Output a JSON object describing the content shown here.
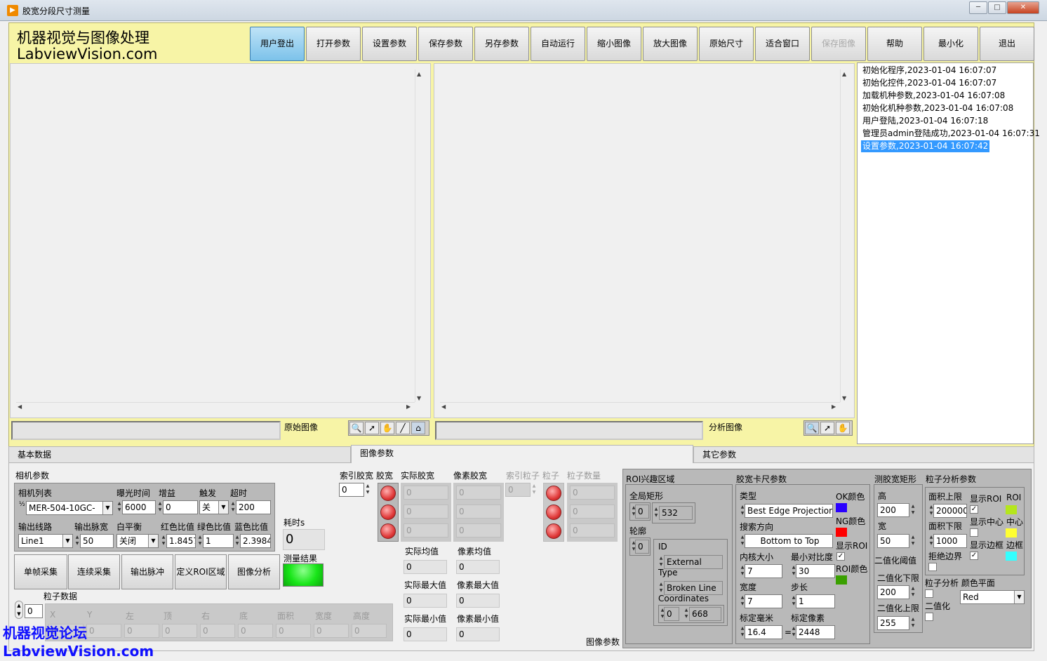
{
  "window": {
    "title": "胶宽分段尺寸测量",
    "icon": "play-icon",
    "controls": [
      "─",
      "□",
      "✕"
    ]
  },
  "brand": {
    "line1": "机器视觉与图像处理",
    "line2": "LabviewVision.com"
  },
  "toolbar": {
    "buttons": [
      "用户登出",
      "打开参数",
      "设置参数",
      "保存参数",
      "另存参数",
      "自动运行",
      "缩小图像",
      "放大图像",
      "原始尺寸",
      "适合窗口",
      "保存图像",
      "帮助",
      "最小化",
      "退出"
    ],
    "active": "用户登出",
    "disabled": "保存图像"
  },
  "panels": {
    "original_label": "原始图像",
    "analysis_label": "分析图像"
  },
  "log": {
    "items": [
      "初始化程序,2023-01-04 16:07:07",
      "初始化控件,2023-01-04 16:07:07",
      "加载机种参数,2023-01-04 16:07:08",
      "初始化机种参数,2023-01-04 16:07:08",
      "用户登陆,2023-01-04 16:07:18",
      "管理员admin登陆成功,2023-01-04 16:07:31",
      "设置参数,2023-01-04 16:07:42"
    ],
    "selected_index": 6
  },
  "tabs": {
    "items": [
      "基本数据",
      "图像参数",
      "其它参数"
    ],
    "active": "图像参数",
    "page_label": "图像参数"
  },
  "camera": {
    "title": "相机参数",
    "list_label": "相机列表",
    "list_value": "MER-504-10GC-",
    "exposure_label": "曝光时间",
    "exposure": "6000",
    "gain_label": "增益",
    "gain": "0",
    "trigger_label": "触发",
    "trigger": "关",
    "timeout_label": "超时",
    "timeout": "200",
    "line_label": "输出线路",
    "line": "Line1",
    "pulse_label": "输出脉宽",
    "pulse": "50",
    "wb_label": "白平衡",
    "wb": "关闭",
    "red_label": "红色比值",
    "red": "1.8457",
    "green_label": "绿色比值",
    "green": "1",
    "blue_label": "蓝色比值",
    "blue": "2.3984",
    "index_prefix": "½"
  },
  "elapsed": {
    "label": "耗时s",
    "value": "0"
  },
  "result": {
    "label": "测量结果",
    "color": "#19e619"
  },
  "actions": [
    "单帧采集",
    "连续采集",
    "输出脉冲",
    "定义ROI区域",
    "图像分析"
  ],
  "particles": {
    "title": "粒子数据",
    "index": "0",
    "columns": [
      "X",
      "Y",
      "左",
      "顶",
      "右",
      "底",
      "面积",
      "宽度",
      "高度"
    ],
    "row": [
      "0",
      "0",
      "0",
      "0",
      "0",
      "0",
      "0",
      "0",
      "0"
    ]
  },
  "glue": {
    "index_label": "索引胶宽",
    "index": "0",
    "led_label": "胶宽",
    "actual_label": "实际胶宽",
    "pixel_label": "像素胶宽",
    "actual": [
      "0",
      "0",
      "0"
    ],
    "pixel": [
      "0",
      "0",
      "0"
    ],
    "mean_actual_label": "实际均值",
    "mean_pixel_label": "像素均值",
    "mean_actual": "0",
    "mean_pixel": "0",
    "max_actual_label": "实际最大值",
    "max_pixel_label": "像素最大值",
    "max_actual": "0",
    "max_pixel": "0",
    "min_actual_label": "实际最小值",
    "min_pixel_label": "像素最小值",
    "min_actual": "0",
    "min_pixel": "0"
  },
  "particle_idx": {
    "index_label": "索引粒子",
    "index": "0",
    "led_label": "粒子",
    "count_label": "粒子数量",
    "counts": [
      "0",
      "0",
      "0"
    ]
  },
  "roi": {
    "title": "ROI兴趣区域",
    "global_label": "全局矩形",
    "global_index": "0",
    "global_value": "532",
    "contour_label": "轮廓",
    "contour_index": "0",
    "id_label": "ID",
    "id_value": "External",
    "type_label": "Type",
    "type_value": "Broken Line",
    "coords_label": "Coordinates",
    "coords_index": "0",
    "coords_value": "668"
  },
  "caliper": {
    "title": "胶宽卡尺参数",
    "type_label": "类型",
    "type_value": "Best Edge Projection",
    "dir_label": "搜索方向",
    "dir_value": "Bottom to Top",
    "kernel_label": "内核大小",
    "kernel": "7",
    "contrast_label": "最小对比度",
    "contrast": "30",
    "width_label": "宽度",
    "width": "7",
    "step_label": "步长",
    "step": "1",
    "mm_label": "标定毫米",
    "mm": "16.4",
    "eq": "=",
    "px_label": "标定像素",
    "px": "2448",
    "ok_label": "OK颜色",
    "ok_color": "#2a00ff",
    "ng_label": "NG颜色",
    "ng_color": "#ff0000",
    "show_roi_label": "显示ROI",
    "roi_color_label": "ROI颜色",
    "roi_color": "#3aa000"
  },
  "rect": {
    "title": "测胶宽矩形",
    "height_label": "高",
    "height": "200",
    "width_label": "宽",
    "width": "50",
    "bin_title": "二值化阈值",
    "low_label": "二值化下限",
    "low": "200",
    "high_label": "二值化上限",
    "high": "255"
  },
  "particle_params": {
    "title": "粒子分析参数",
    "area_max_label": "面积上限",
    "area_max": "200000",
    "area_min_label": "面积下限",
    "area_min": "1000",
    "reject_label": "拒绝边界",
    "show_roi_label": "显示ROI",
    "show_center_label": "显示中心",
    "show_edge_label": "显示边框",
    "roi_label": "ROI",
    "center_label": "中心",
    "edge_label": "边框",
    "roi_color": "#b5e61d",
    "center_color": "#ffff33",
    "edge_color": "#33ffff",
    "plane_label": "粒子分析 颜色平面",
    "binarize_label": "二值化",
    "plane_value": "Red"
  },
  "watermark": {
    "line1": "机器视觉论坛",
    "line2": "LabviewVision.com"
  }
}
